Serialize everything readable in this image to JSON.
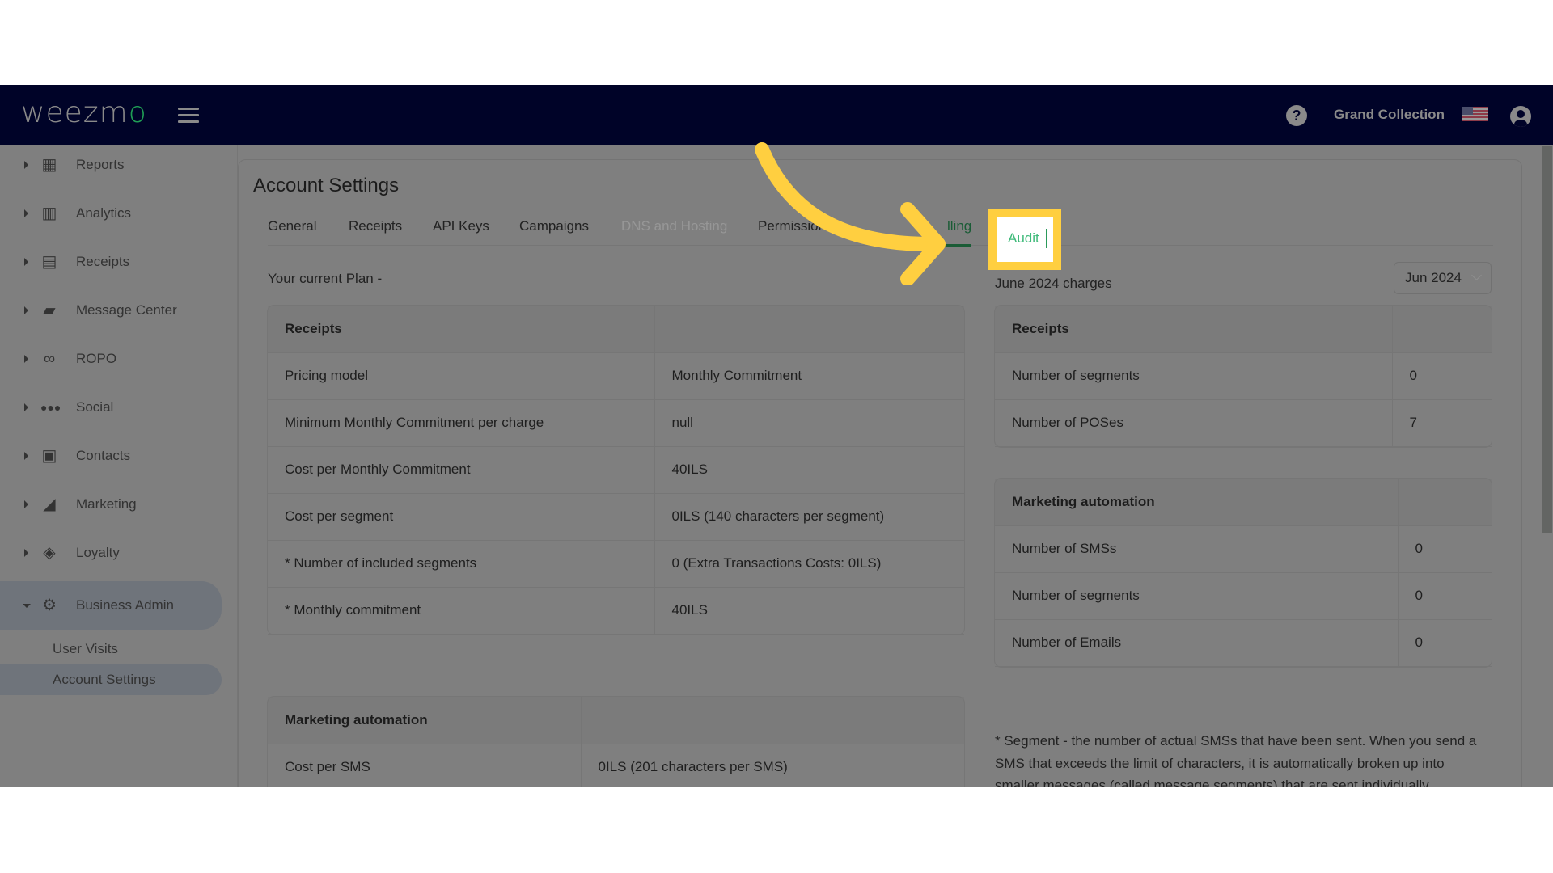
{
  "header": {
    "logo_text": "weezm",
    "logo_accent": "o",
    "account_name": "Grand Collection",
    "icons": [
      "menu-icon",
      "help-icon",
      "us-flag-icon",
      "user-account-icon"
    ]
  },
  "sidebar": {
    "items": [
      {
        "label": "Reports",
        "icon": "dashboard-icon",
        "expanded": false
      },
      {
        "label": "Analytics",
        "icon": "bar-chart-icon",
        "expanded": false
      },
      {
        "label": "Receipts",
        "icon": "receipt-icon",
        "expanded": false
      },
      {
        "label": "Message Center",
        "icon": "chat-icon",
        "expanded": false
      },
      {
        "label": "ROPO",
        "icon": "infinity-icon",
        "expanded": false
      },
      {
        "label": "Social",
        "icon": "people-icon",
        "expanded": false
      },
      {
        "label": "Contacts",
        "icon": "contact-card-icon",
        "expanded": false
      },
      {
        "label": "Marketing",
        "icon": "party-popper-icon",
        "expanded": false
      },
      {
        "label": "Loyalty",
        "icon": "tag-heart-icon",
        "expanded": false
      },
      {
        "label": "Business Admin",
        "icon": "gear-icon",
        "expanded": true
      }
    ],
    "sub_items": [
      {
        "label": "User Visits",
        "active": false
      },
      {
        "label": "Account Settings",
        "active": true
      }
    ]
  },
  "page": {
    "title": "Account Settings",
    "tabs": [
      {
        "label": "General",
        "state": "normal"
      },
      {
        "label": "Receipts",
        "state": "normal"
      },
      {
        "label": "API Keys",
        "state": "normal"
      },
      {
        "label": "Campaigns",
        "state": "normal"
      },
      {
        "label": "DNS and Hosting",
        "state": "disabled"
      },
      {
        "label": "Permissions",
        "state": "normal"
      },
      {
        "label": "lling",
        "state": "active"
      },
      {
        "label": "Audit",
        "state": "highlighted"
      }
    ],
    "plan_label": "Your current Plan -",
    "plan_tables": [
      {
        "header": "Receipts",
        "rows": [
          [
            "Pricing model",
            "Monthly Commitment"
          ],
          [
            "Minimum Monthly Commitment per charge",
            "null"
          ],
          [
            "Cost per Monthly Commitment",
            "40ILS"
          ],
          [
            "Cost per segment",
            "0ILS (140 characters per segment)"
          ],
          [
            "* Number of included segments",
            "0 (Extra Transactions Costs: 0ILS)"
          ],
          [
            "* Monthly commitment",
            "40ILS"
          ]
        ]
      },
      {
        "header": "Marketing automation",
        "rows": [
          [
            "Cost per SMS",
            "0ILS (201 characters per SMS)"
          ]
        ]
      }
    ],
    "charges": {
      "label": "June 2024 charges",
      "month_select_value": "Jun 2024",
      "tables": [
        {
          "header": "Receipts",
          "rows": [
            [
              "Number of segments",
              "0"
            ],
            [
              "Number of POSes",
              "7"
            ]
          ]
        },
        {
          "header": "Marketing automation",
          "rows": [
            [
              "Number of SMSs",
              "0"
            ],
            [
              "Number of segments",
              "0"
            ],
            [
              "Number of Emails",
              "0"
            ]
          ]
        }
      ],
      "footnote": "* Segment - the number of actual SMSs that have been sent. When you send a SMS that exceeds the limit of characters, it is automatically broken up into smaller messages (called message segments) that are sent individually."
    }
  },
  "colors": {
    "topbar": "#000328",
    "accent_green": "#1a5c36",
    "highlight_yellow": "#ffcf40",
    "audit_text": "#3fba7a"
  }
}
